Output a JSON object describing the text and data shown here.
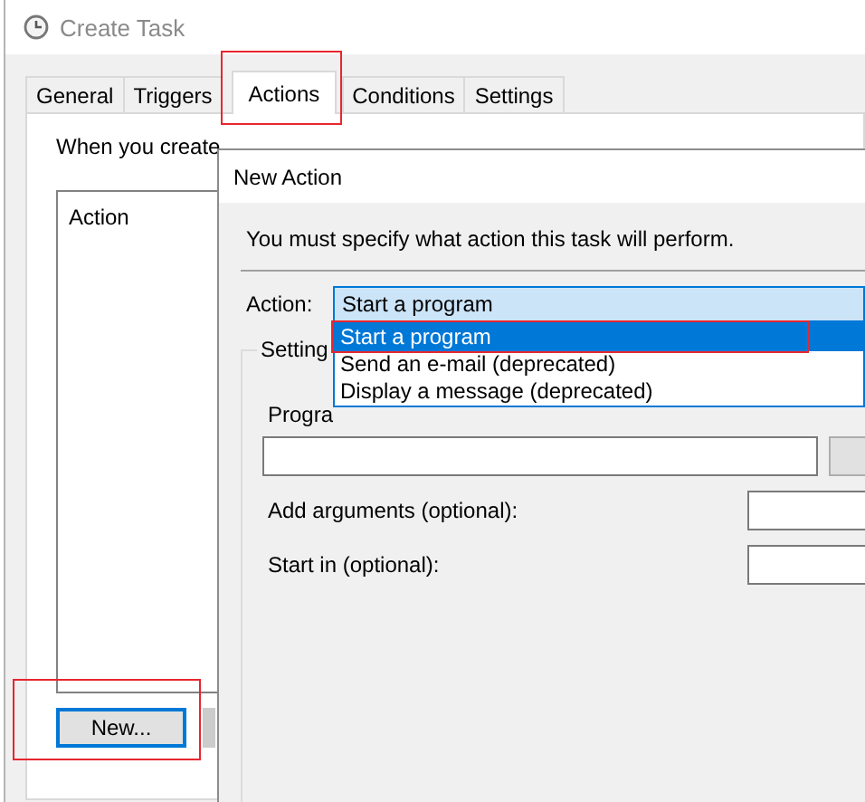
{
  "main_window": {
    "title": "Create Task",
    "tabs": [
      {
        "label": "General",
        "selected": false,
        "highlighted": false
      },
      {
        "label": "Triggers",
        "selected": false,
        "highlighted": false
      },
      {
        "label": "Actions",
        "selected": true,
        "highlighted": true
      },
      {
        "label": "Conditions",
        "selected": false,
        "highlighted": false
      },
      {
        "label": "Settings",
        "selected": false,
        "highlighted": false
      }
    ],
    "description": "When you create",
    "list": {
      "column": "Action"
    },
    "new_button": {
      "label": "New...",
      "focused": true,
      "highlighted": true
    }
  },
  "dialog": {
    "title": "New Action",
    "instruction": "You must specify what action this task will perform.",
    "action": {
      "label": "Action:",
      "value": "Start a program",
      "expanded": true,
      "options": [
        {
          "label": "Start a program",
          "selected": true,
          "highlighted": true
        },
        {
          "label": "Send an e-mail (deprecated)",
          "selected": false,
          "highlighted": false
        },
        {
          "label": "Display a message (deprecated)",
          "selected": false,
          "highlighted": false
        }
      ]
    },
    "settings": {
      "label": "Setting",
      "fields": [
        {
          "kind": "stacked",
          "label": "Progra"
        },
        {
          "kind": "inline",
          "label": "Add arguments (optional):"
        },
        {
          "kind": "inline",
          "label": "Start in (optional):"
        }
      ]
    }
  }
}
